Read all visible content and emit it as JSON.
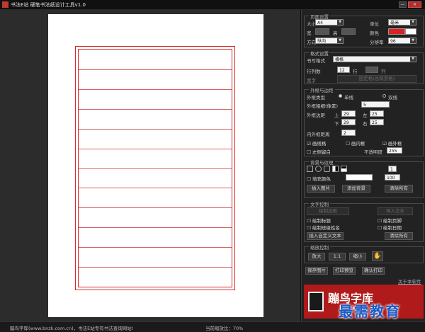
{
  "window": {
    "title": "书法E站 硬笔书法纸设计工具v1.0",
    "min_label": "—",
    "max_label": "□",
    "close_label": "✕"
  },
  "paper": {
    "rows": 12
  },
  "page_settings": {
    "title": "页面设置",
    "size_label": "大小",
    "size_value": "A4",
    "unit_label": "单位",
    "unit_value": "毫米",
    "width_label": "宽",
    "height_label": "高",
    "color_label": "颜色",
    "orientation_label": "方向",
    "orientation_value": "纵向",
    "resolution_label": "分辨率",
    "resolution_value": "96",
    "accent_color": "#e02020"
  },
  "format_settings": {
    "title": "格式设置",
    "format_label": "书写格式",
    "format_value": "横格",
    "rows_label": "行列数",
    "rows_value": "12",
    "rows_unit": "行",
    "cols_unit": "列",
    "width_label": "宽字",
    "width_btn": "固定格(总跨页格)"
  },
  "border_settings": {
    "title": "外框与边距",
    "type_label": "外框类型",
    "type_single": "单线",
    "type_double": "双线",
    "thickness_label": "外框粗细(像素)",
    "thickness_value": "5",
    "margin_label": "外框边距",
    "top_label": "上",
    "top_value": "29",
    "left_label": "左",
    "left_value": "25",
    "bottom_label": "下",
    "bottom_value": "29",
    "right_label": "右",
    "right_value": "25",
    "inner_label": "内外框距离",
    "inner_value": "2",
    "chk_line": "画线格",
    "chk_inner": "画内框",
    "chk_outer": "画外框",
    "chk_blank": "左侧留白",
    "opacity_label": "不透明度",
    "opacity_value": "255"
  },
  "background": {
    "title": "背景与纹理",
    "fill_label": "填充颜色",
    "opacity_value": "100",
    "count_value": "1",
    "insert_image": "插入图片",
    "add_bg": "添加背景",
    "clear_all": "清除所有"
  },
  "text_settings": {
    "title": "文字控制",
    "btn_a": "绘制边框",
    "btn_b": "导入文本",
    "chk_title": "绘制标题",
    "chk_footer": "绘制页脚",
    "chk_name": "绘制班级姓名",
    "chk_date": "绘制日期",
    "insert_custom": "插入自定义文本",
    "clear_all": "清除所有"
  },
  "zoom": {
    "title": "缩放控制",
    "zoom_in": "放大",
    "actual": "1:1",
    "zoom_out": "缩小"
  },
  "actions": {
    "save": "保存图片",
    "print_preview": "打印预览",
    "print_confirm": "确认打印",
    "about": "关于本软件"
  },
  "logo": {
    "text": "蹦鸟字库",
    "sub": "bnzk"
  },
  "statusbar": {
    "left": "蹦鸟字库(www.bnzk.com.cn)，书法E站专有书法查询网站!",
    "zoom": "当前缩放比：70%"
  },
  "watermark": "最需教育"
}
